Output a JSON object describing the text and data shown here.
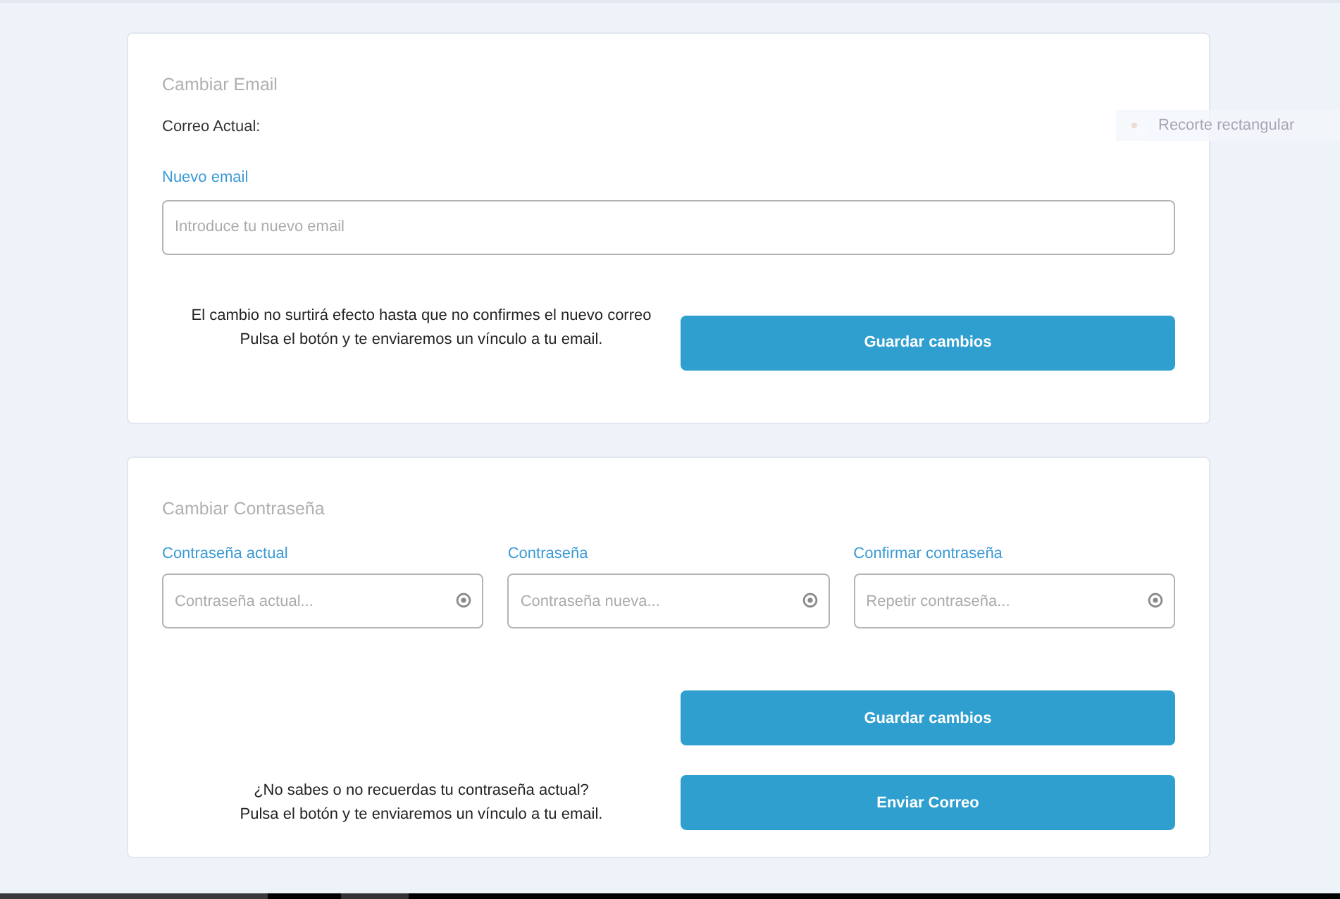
{
  "email_card": {
    "title": "Cambiar Email",
    "current_label": "Correo Actual:",
    "field_label": "Nuevo email",
    "field": {
      "placeholder": "Introduce tu nuevo email"
    },
    "notice_lines": [
      "El cambio no surtirá efecto hasta que no confirmes el nuevo correo",
      "Pulsa el botón y te enviaremos un vínculo a tu email."
    ],
    "button": "Guardar cambios"
  },
  "toast": {
    "text": "Recorte rectangular"
  },
  "password_card": {
    "title": "Cambiar Contraseña",
    "fields": [
      {
        "label": "Contraseña actual",
        "placeholder": "Contraseña actual..."
      },
      {
        "label": "Contraseña",
        "placeholder": "Contraseña nueva..."
      },
      {
        "label": "Confirmar contraseña",
        "placeholder": "Repetir contraseña..."
      }
    ],
    "save_button": "Guardar cambios",
    "forgot_lines": [
      "¿No sabes o no recuerdas tu contraseña actual?",
      "Pulsa el botón y te enviaremos un vínculo a tu email."
    ],
    "send_button": "Enviar Correo"
  }
}
